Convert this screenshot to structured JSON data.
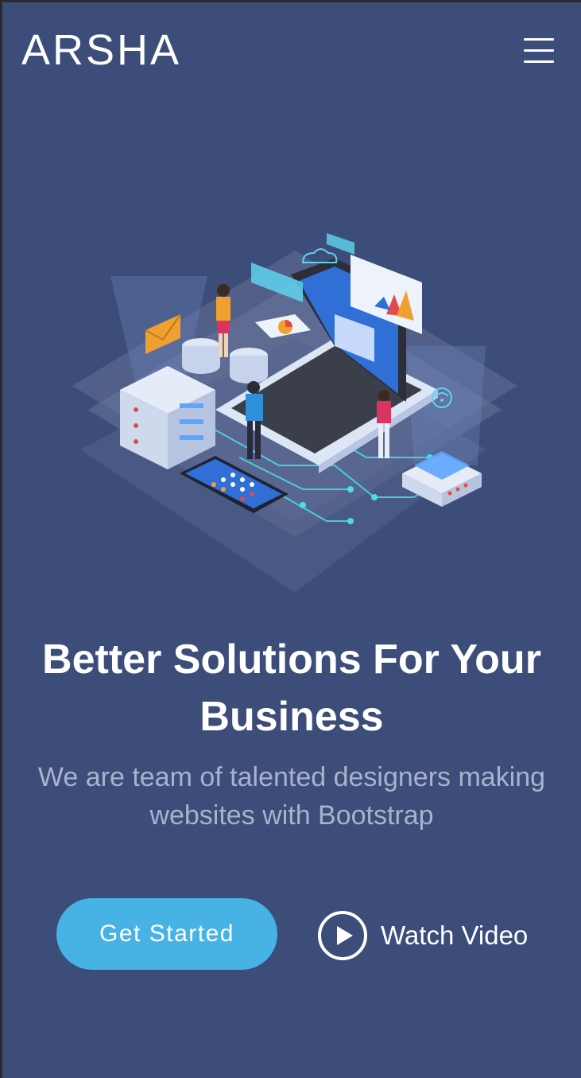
{
  "header": {
    "logo": "ARSHA",
    "menu_icon": "hamburger-menu-icon"
  },
  "hero": {
    "illustration": "isometric-tech-illustration",
    "headline_line1": "Better Solutions For Your",
    "headline_line2": "Business",
    "subtitle_line1": "We are team of talented designers making",
    "subtitle_line2": "websites with Bootstrap",
    "primary_button": "Get Started",
    "video_button": "Watch Video",
    "video_icon": "play-circle-icon"
  },
  "colors": {
    "background": "#3d4d79",
    "accent": "#47b2e4",
    "subtitle": "#a9b2cc"
  }
}
